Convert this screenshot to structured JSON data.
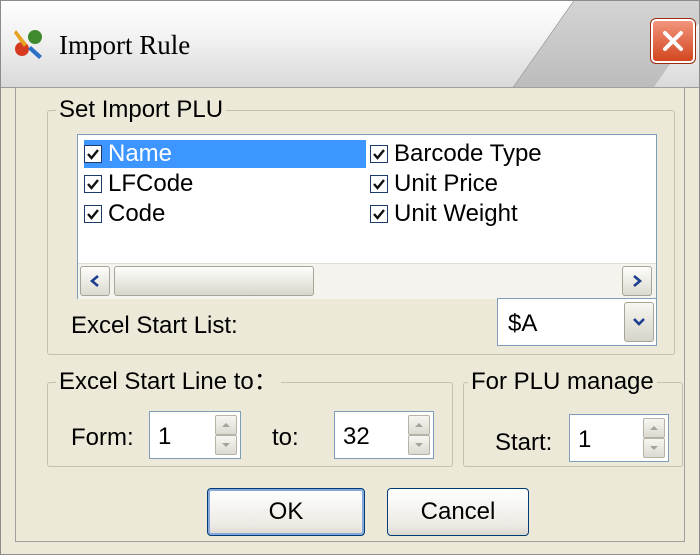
{
  "window": {
    "title": "Import Rule",
    "icons": {
      "app": "tools-icon",
      "close": "close-icon"
    }
  },
  "plu_group": {
    "legend": "Set Import PLU",
    "fields": [
      {
        "label": "Name",
        "checked": true,
        "selected": true
      },
      {
        "label": "LFCode",
        "checked": true,
        "selected": false
      },
      {
        "label": "Code",
        "checked": true,
        "selected": false
      },
      {
        "label": "Barcode Type",
        "checked": true,
        "selected": false
      },
      {
        "label": "Unit Price",
        "checked": true,
        "selected": false
      },
      {
        "label": "Unit Weight",
        "checked": true,
        "selected": false
      }
    ],
    "excel_start_list": {
      "label": "Excel Start List:",
      "value": "$A"
    }
  },
  "start_line_group": {
    "legend": "Excel Start Line to：",
    "form_label": "Form:",
    "form_value": "1",
    "to_label": "to:",
    "to_value": "32"
  },
  "plu_manage_group": {
    "legend": "For PLU manage",
    "start_label": "Start:",
    "start_value": "1"
  },
  "buttons": {
    "ok": "OK",
    "cancel": "Cancel"
  },
  "colors": {
    "selection": "#3d95ff",
    "close": "#d2461f",
    "face": "#ece9d8"
  }
}
